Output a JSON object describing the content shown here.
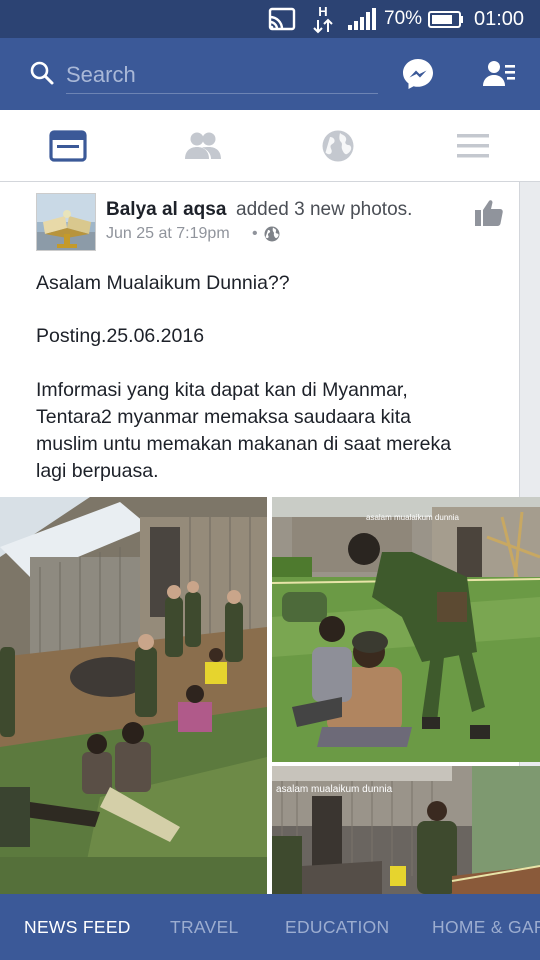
{
  "status_bar": {
    "network_type": "H",
    "battery_percent": "70%",
    "time": "01:00"
  },
  "header": {
    "search_placeholder": "Search",
    "icons": [
      "search-icon",
      "messenger-icon",
      "friend-requests-icon"
    ]
  },
  "tabs": [
    {
      "name": "news-feed",
      "icon": "feed-icon",
      "active": true
    },
    {
      "name": "friends",
      "icon": "friends-icon",
      "active": false
    },
    {
      "name": "notifications",
      "icon": "globe-icon",
      "active": false
    },
    {
      "name": "menu",
      "icon": "menu-icon",
      "active": false
    }
  ],
  "post": {
    "author": "Balya al aqsa",
    "action": "added 3 new photos.",
    "date": "Jun 25 at 7:19pm",
    "dot": "•",
    "text_lines": [
      "Asalam Mualaikum Dunnia??",
      "Posting.25.06.2016",
      "Imformasi yang kita dapat kan di Myanmar,",
      "Tentara2 myanmar memaksa saudaara kita",
      "muslim untu memakan makanan di saat mereka",
      "lagi berpuasa."
    ],
    "photo_watermarks": [
      "asalam mualaikum dunnia",
      "asalam mualaikum dunnia"
    ]
  },
  "bottom_nav": {
    "items": [
      "NEWS FEED",
      "TRAVEL",
      "EDUCATION",
      "HOME & GAR"
    ]
  },
  "colors": {
    "facebook_blue": "#3b5998",
    "status_bar": "#2c4373",
    "inactive_nav": "#9cadd0",
    "body_text": "#1d2129",
    "secondary_text": "#90949c"
  }
}
